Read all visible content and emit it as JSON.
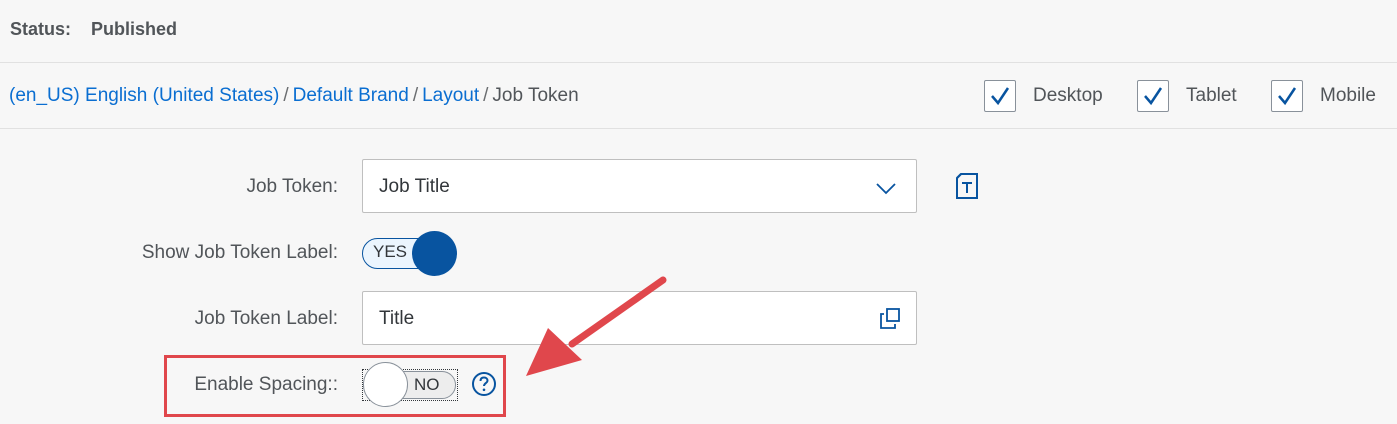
{
  "status": {
    "label": "Status:",
    "value": "Published"
  },
  "breadcrumb": {
    "items": [
      {
        "label": "(en_US) English (United States)"
      },
      {
        "label": "Default Brand"
      },
      {
        "label": "Layout"
      },
      {
        "label": "Job Token"
      }
    ],
    "separator": "/"
  },
  "devices": [
    {
      "label": "Desktop",
      "checked": true
    },
    {
      "label": "Tablet",
      "checked": true
    },
    {
      "label": "Mobile",
      "checked": true
    }
  ],
  "form": {
    "job_token": {
      "label": "Job Token:",
      "value": "Job Title"
    },
    "show_label": {
      "label": "Show Job Token Label:",
      "state": "YES"
    },
    "token_label": {
      "label": "Job Token Label:",
      "value": "Title"
    },
    "enable_spacing": {
      "label": "Enable Spacing::",
      "state": "NO"
    }
  },
  "icons": {
    "dropdown": "chevron-down-icon",
    "token": "text-token-icon",
    "copy": "copy-icon",
    "help": "question-mark-icon"
  },
  "colors": {
    "link": "#0a6ed1",
    "accent": "#0854a0",
    "annotation": "#e0474c"
  }
}
